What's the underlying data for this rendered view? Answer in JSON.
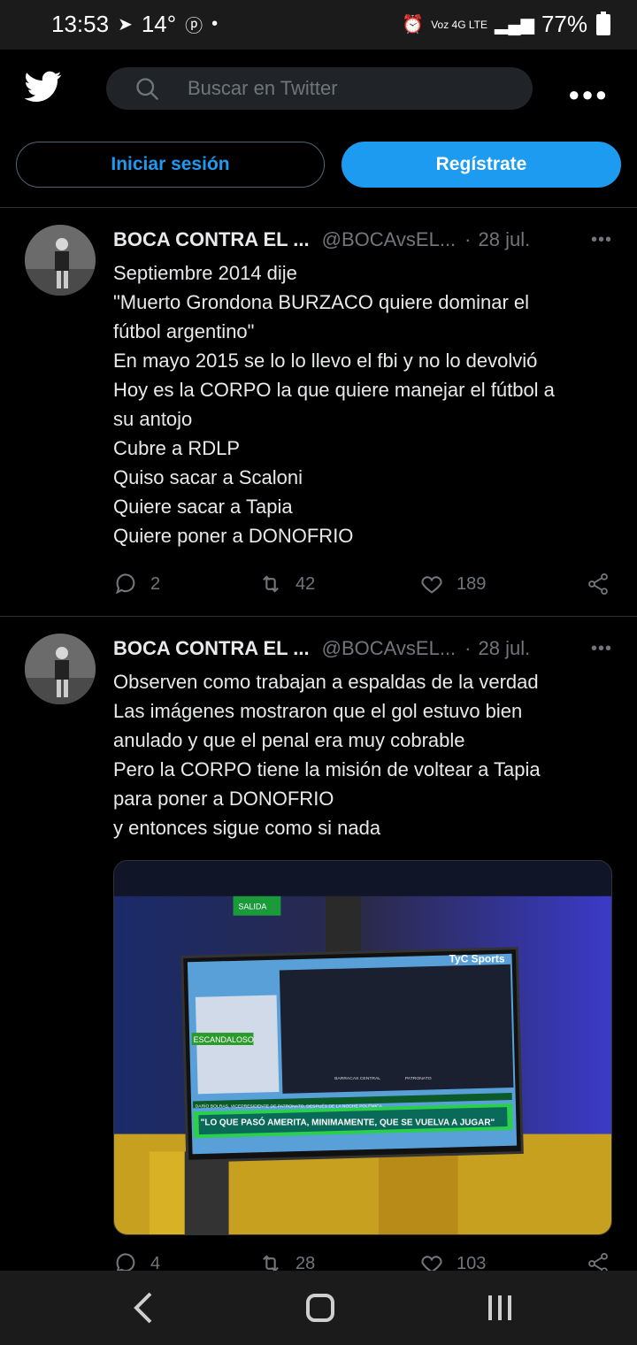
{
  "status": {
    "time": "13:53",
    "temp": "14°",
    "dot": "•",
    "network": "Voz 4G LTE",
    "battery": "77%"
  },
  "topbar": {
    "search_placeholder": "Buscar en Twitter"
  },
  "auth": {
    "login_label": "Iniciar sesión",
    "signup_label": "Regístrate"
  },
  "tweets": [
    {
      "name": "BOCA CONTRA EL ...",
      "handle": "@BOCAvsEL...",
      "separator": "·",
      "date": "28 jul.",
      "lines": [
        "Septiembre 2014  dije",
        "\"Muerto Grondona BURZACO quiere dominar el",
        "fútbol argentino\"",
        "En mayo 2015 se lo lo llevo el fbi y no lo devolvió",
        "Hoy es la CORPO la que quiere manejar el fútbol a",
        "su antojo",
        "Cubre a RDLP",
        "Quiso sacar a Scaloni",
        "Quiere sacar a Tapia",
        "Quiere poner a DONOFRIO"
      ],
      "replies": "2",
      "retweets": "42",
      "likes": "189"
    },
    {
      "name": "BOCA CONTRA EL ...",
      "handle": "@BOCAvsEL...",
      "separator": "·",
      "date": "28 jul.",
      "lines": [
        "Observen como trabajan a espaldas de la verdad",
        "Las imágenes mostraron que el gol estuvo bien",
        "anulado y que el penal era muy cobrable",
        "Pero la CORPO tiene la misión de voltear a Tapia",
        "para poner a DONOFRIO",
        "y entonces sigue como si nada"
      ],
      "media": {
        "exit_sign": "SALIDA",
        "channel": "TyC Sports",
        "tag": "ESCANDALOSO",
        "ticker": "DARÍO BOLRAS, VICEPRESIDENTE DE PATRONATO, DESPUÉS DE LA NOCHE POLÉMICA",
        "headline": "\"LO QUE PASÓ AMERITA, MINIMAMENTE, QUE SE VUELVA A JUGAR\"",
        "score_left": "BARRACAS CENTRAL",
        "score_right": "PATRONATO"
      },
      "replies": "4",
      "retweets": "28",
      "likes": "103"
    }
  ],
  "colors": {
    "accent": "#1d9bf0",
    "background": "#000000",
    "muted": "#71767b",
    "text": "#e7e9ea"
  }
}
